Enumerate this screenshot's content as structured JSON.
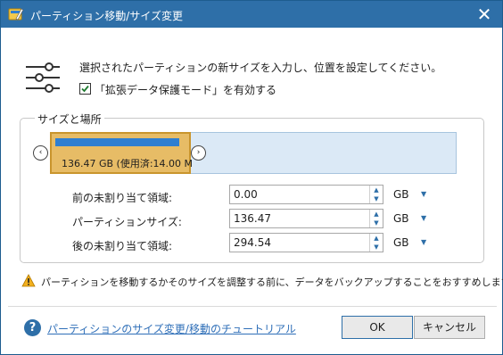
{
  "window": {
    "title": "パーティション移動/サイズ変更",
    "app_icon": "partition-wizard-app-icon",
    "close_glyph": "✕",
    "accent_color": "#2e6fa8"
  },
  "intro": {
    "icon": "sliders-icon",
    "instruction": "選択されたパーティションの新サイズを入力し、位置を設定してください。",
    "checkbox_label": "「拡張データ保護モード」を有効する",
    "checkbox_checked": true
  },
  "size_location": {
    "group_title": "サイズと場所",
    "partition_label": "136.47 GB (使用済:14.00 M",
    "used_fraction": 0.95,
    "left_arrow": "‹",
    "right_arrow": "›",
    "partition_color": "#e7bc66",
    "free_space_color": "#dbe9f6",
    "used_bar_color": "#2f7fd1",
    "fields": [
      {
        "label": "前の未割り当て領域:",
        "value": "0.00",
        "unit": "GB"
      },
      {
        "label": "パーティションサイズ:",
        "value": "136.47",
        "unit": "GB"
      },
      {
        "label": "後の未割り当て領域:",
        "value": "294.54",
        "unit": "GB"
      }
    ]
  },
  "warning": {
    "icon": "warning-icon",
    "text": "パーティションを移動するかそのサイズを調整する前に、データをバックアップすることをおすすめします。"
  },
  "footer": {
    "help_icon": "help-icon",
    "help_glyph": "?",
    "help_link": "パーティションのサイズ変更/移動のチュートリアル",
    "ok_label": "OK",
    "cancel_label": "キャンセル"
  }
}
